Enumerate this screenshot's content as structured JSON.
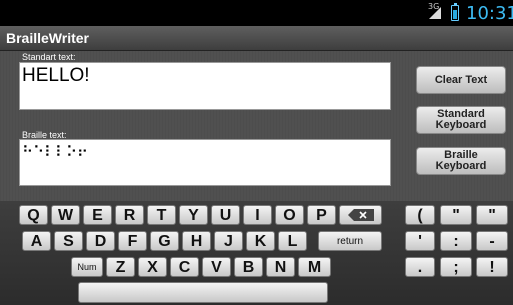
{
  "status": {
    "network": "3G",
    "time": "10:31"
  },
  "app": {
    "title": "BrailleWriter"
  },
  "standard": {
    "label": "Standart text:",
    "value": "HELLO!"
  },
  "braille": {
    "label": "Braille text:",
    "value": "⠓⠑⠇⠇⠕⠖"
  },
  "buttons": {
    "clear": "Clear Text",
    "standard_keyboard": "Standard\nKeyboard",
    "braille_keyboard": "Braille\nKeyboard"
  },
  "keyboard": {
    "row1": [
      "Q",
      "W",
      "E",
      "R",
      "T",
      "Y",
      "U",
      "I",
      "O",
      "P"
    ],
    "row2": [
      "A",
      "S",
      "D",
      "F",
      "G",
      "H",
      "J",
      "K",
      "L"
    ],
    "row3": [
      "Z",
      "X",
      "C",
      "V",
      "B",
      "N",
      "M"
    ],
    "num_label": "Num",
    "return_label": "return",
    "backspace_icon": "backspace-icon",
    "symbols": [
      "(",
      "\"",
      "\"",
      "'",
      ":",
      "-",
      ".",
      ";",
      "!"
    ]
  }
}
